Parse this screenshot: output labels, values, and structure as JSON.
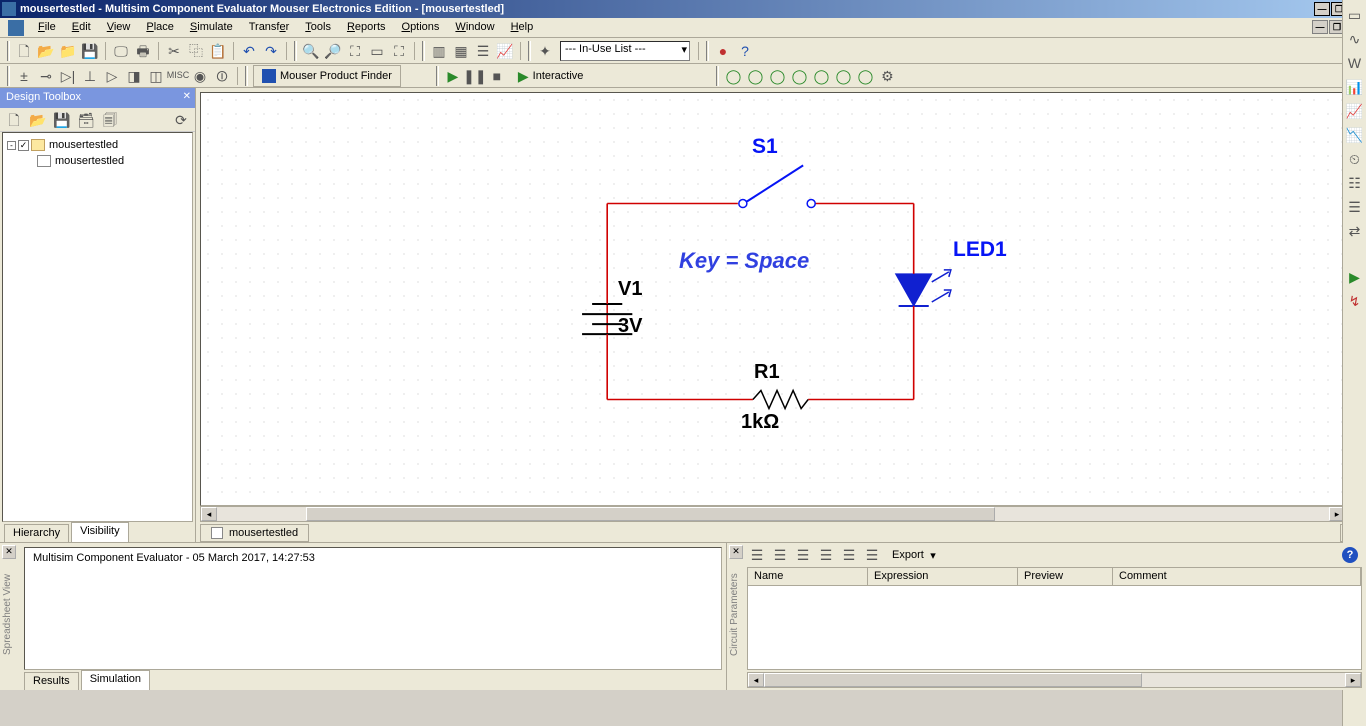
{
  "title": "mousertestled - Multisim Component Evaluator Mouser Electronics Edition - [mousertestled]",
  "menu": {
    "file": "File",
    "edit": "Edit",
    "view": "View",
    "place": "Place",
    "simulate": "Simulate",
    "transfer": "Transfer",
    "tools": "Tools",
    "reports": "Reports",
    "options": "Options",
    "window": "Window",
    "help": "Help"
  },
  "toolbar1": {
    "inuse": "--- In-Use List ---"
  },
  "toolbar2": {
    "mouser_finder": "Mouser Product Finder",
    "interactive": "Interactive"
  },
  "design_toolbox": {
    "title": "Design Toolbox",
    "root": "mousertestled",
    "child": "mousertestled",
    "tabs": [
      "Hierarchy",
      "Visibility"
    ],
    "active_tab": "Visibility"
  },
  "canvas_tab": "mousertestled",
  "schematic": {
    "s1": "S1",
    "key": "Key = Space",
    "led1": "LED1",
    "v1_name": "V1",
    "v1_val": "3V",
    "r1_name": "R1",
    "r1_val": "1kΩ"
  },
  "log": {
    "line": "Multisim Component Evaluator  -  05 March 2017, 14:27:53",
    "tabs": [
      "Results",
      "Simulation"
    ],
    "active_tab": "Simulation",
    "side_label": "Spreadsheet View"
  },
  "params": {
    "export": "Export",
    "headers": [
      "Name",
      "Expression",
      "Preview",
      "Comment"
    ],
    "side_label": "Circuit Parameters"
  }
}
